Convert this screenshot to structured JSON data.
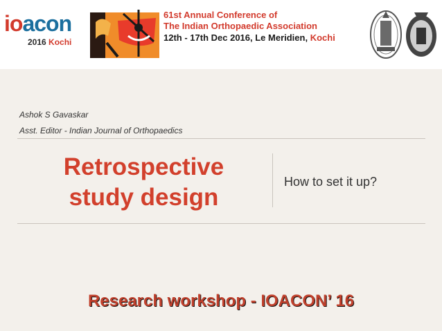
{
  "header": {
    "logo": {
      "word_i": "i",
      "word_o": "o",
      "word_rest": "acon",
      "year": "2016",
      "city": "Kochi"
    },
    "conference": {
      "line1": "61st Annual Conference of",
      "line2": "The Indian Orthopaedic Association",
      "line3_prefix": "12th - 17th Dec 2016, Le Meridien, ",
      "line3_city": "Kochi"
    },
    "icons": [
      "conference-artwork-icon",
      "state-emblem-icon",
      "university-seal-icon"
    ]
  },
  "slide": {
    "author": "Ashok S Gavaskar",
    "role": "Asst. Editor - Indian Journal of Orthopaedics",
    "title_line1": "Retrospective",
    "title_line2": "study design",
    "subtitle": "How to set it up?",
    "footer": "Research workshop - IOACON’ 16"
  },
  "colors": {
    "accent": "#d2402c",
    "brand_blue": "#1b6f9e",
    "background": "#f3f0eb"
  }
}
